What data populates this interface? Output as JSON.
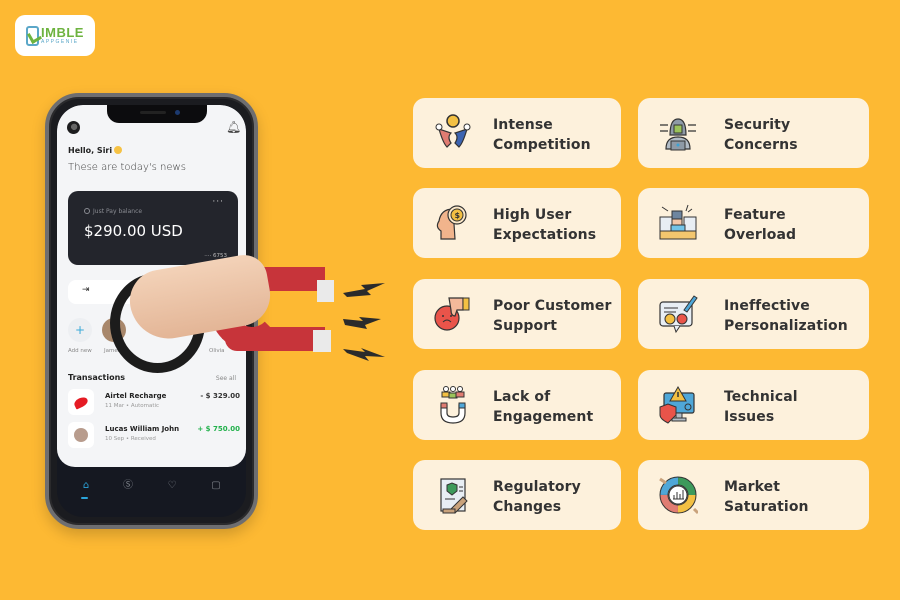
{
  "logo": {
    "main": "NIMBLE",
    "display_main": "IMBLE",
    "sub": "APPGENIE"
  },
  "phone": {
    "greeting": "Hello, Siri",
    "subtitle": "These are today's news",
    "balance_card": {
      "label": "Just Pay balance",
      "amount": "$290.00 USD",
      "menu": "···",
      "card_number": "···· 6753"
    },
    "contacts": [
      {
        "label": "Add new",
        "icon": "plus-icon"
      },
      {
        "label": "James",
        "icon": "avatar"
      },
      {
        "label": "Olivia",
        "icon": "avatar"
      }
    ],
    "transactions_title": "Transactions",
    "see_all": "See all",
    "transactions": [
      {
        "name": "Airtel Recharge",
        "meta": "11 Mar • Automatic",
        "amount": "- $ 329.00",
        "direction": "debit",
        "icon": "airtel-logo"
      },
      {
        "name": "Lucas William John",
        "meta": "10 Sep • Received",
        "amount": "+ $ 750.00",
        "direction": "credit",
        "icon": "avatar"
      }
    ],
    "tabbar": [
      {
        "icon": "home-icon",
        "glyph": "⌂",
        "active": true
      },
      {
        "icon": "dollar-icon",
        "glyph": "Ⓢ",
        "active": false
      },
      {
        "icon": "heart-icon",
        "glyph": "♡",
        "active": false
      },
      {
        "icon": "wallet-icon",
        "glyph": "▢",
        "active": false
      }
    ]
  },
  "colors": {
    "background": "#FDB933",
    "card": "#FDF1DC",
    "text": "#333333",
    "accent_blue": "#2AA3D9",
    "magnet_red": "#C7343A",
    "credit_green": "#22B14C"
  },
  "challenges": [
    {
      "line1": "Intense",
      "line2": "Competition",
      "icon": "competition-icon"
    },
    {
      "line1": "Security",
      "line2": "Concerns",
      "icon": "hacker-icon"
    },
    {
      "line1": "High User",
      "line2": "Expectations",
      "icon": "head-dollar-icon"
    },
    {
      "line1": "Feature",
      "line2": "Overload",
      "icon": "overloaded-worker-icon"
    },
    {
      "line1": "Poor Customer",
      "line2": "Support",
      "icon": "thumbs-down-icon"
    },
    {
      "line1": "Ineffective",
      "line2": "Personalization",
      "icon": "feedback-icon"
    },
    {
      "line1": "Lack of",
      "line2": "Engagement",
      "icon": "magnet-users-icon"
    },
    {
      "line1": "Technical",
      "line2": "Issues",
      "icon": "computer-warning-icon"
    },
    {
      "line1": "Regulatory",
      "line2": "Changes",
      "icon": "legal-document-icon"
    },
    {
      "line1": "Market",
      "line2": "Saturation",
      "icon": "market-chart-icon"
    }
  ]
}
